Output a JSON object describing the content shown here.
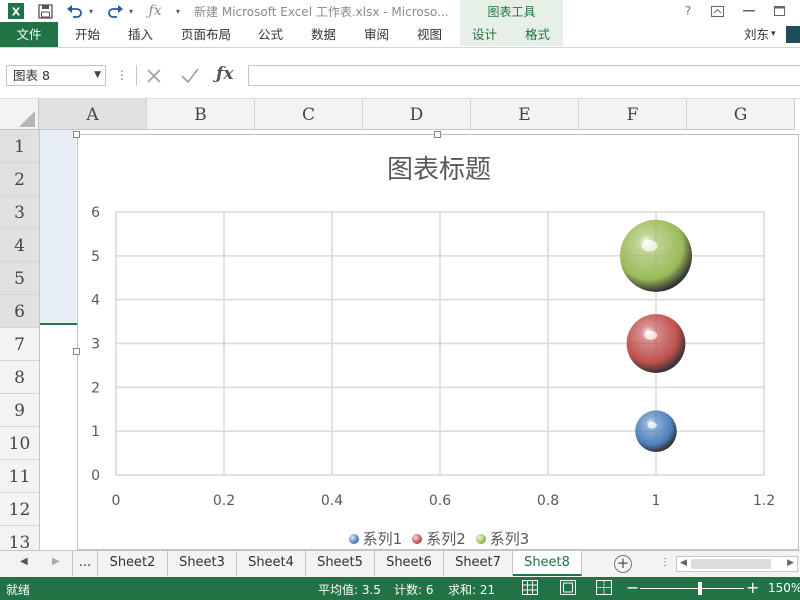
{
  "app": {
    "doc_title": "新建 Microsoft Excel 工作表.xlsx - Microso...",
    "tools_title": "图表工具",
    "help": "?",
    "user": "刘东"
  },
  "ribbon": {
    "file": "文件",
    "tabs": [
      "开始",
      "插入",
      "页面布局",
      "公式",
      "数据",
      "审阅",
      "视图",
      "设计",
      "格式"
    ]
  },
  "formula": {
    "name_box": "图表 8",
    "value": ""
  },
  "columns": [
    "A",
    "B",
    "C",
    "D",
    "E",
    "F",
    "G"
  ],
  "rows": [
    "1",
    "2",
    "3",
    "4",
    "5",
    "6",
    "7",
    "8",
    "9",
    "10",
    "11",
    "12",
    "13"
  ],
  "chart_data": {
    "type": "scatter",
    "title": "图表标题",
    "xlim": [
      0,
      1.2
    ],
    "ylim": [
      0,
      6
    ],
    "x_ticks": [
      "0",
      "0.2",
      "0.4",
      "0.6",
      "0.8",
      "1",
      "1.2"
    ],
    "y_ticks": [
      "0",
      "1",
      "2",
      "3",
      "4",
      "5",
      "6"
    ],
    "grid": true,
    "legend": "bottom",
    "series": [
      {
        "name": "系列1",
        "x": [
          1
        ],
        "y": [
          1
        ],
        "size": [
          1
        ],
        "color": "#4f81bd"
      },
      {
        "name": "系列2",
        "x": [
          1
        ],
        "y": [
          3
        ],
        "size": [
          2
        ],
        "color": "#c0504d"
      },
      {
        "name": "系列3",
        "x": [
          1
        ],
        "y": [
          5
        ],
        "size": [
          3
        ],
        "color": "#9bbb59"
      }
    ]
  },
  "sheets": {
    "more": "...",
    "tabs": [
      "Sheet2",
      "Sheet3",
      "Sheet4",
      "Sheet5",
      "Sheet6",
      "Sheet7",
      "Sheet8"
    ],
    "active": "Sheet8"
  },
  "status": {
    "ready": "就绪",
    "average": "平均值: 3.5",
    "count": "计数: 6",
    "sum": "求和: 21",
    "zoom": "150%"
  }
}
